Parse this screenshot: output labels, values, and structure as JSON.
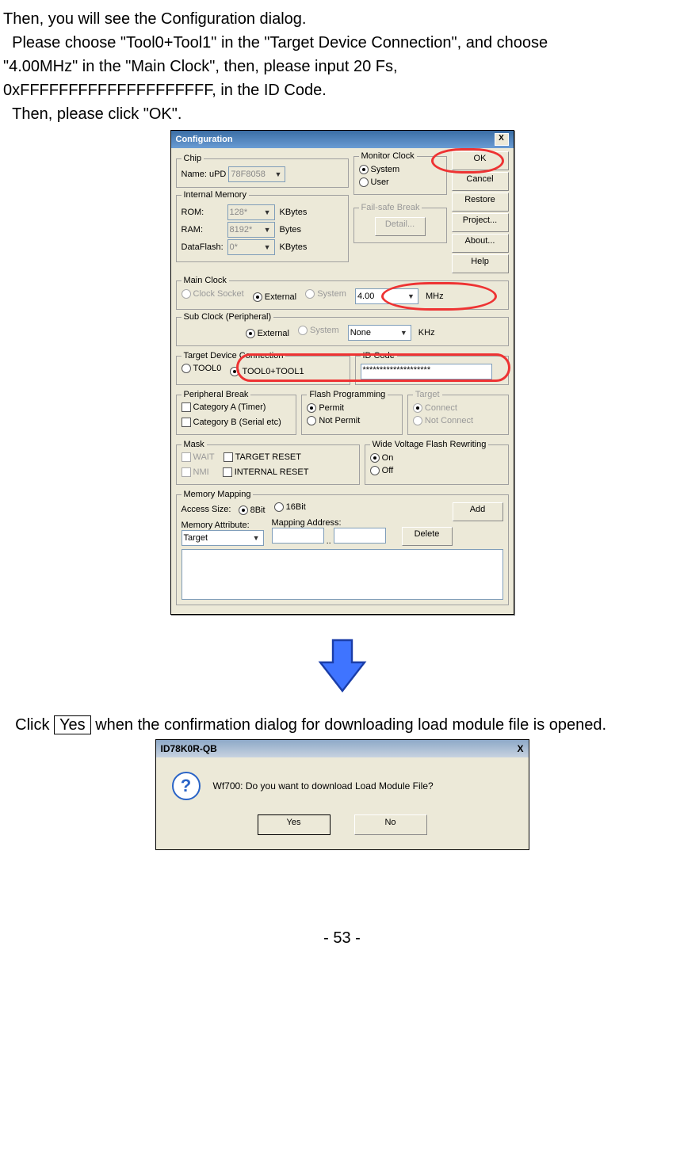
{
  "intro": {
    "l1": "Then, you will see the Configuration dialog.",
    "l2": "Please choose \"Tool0+Tool1\" in the \"Target Device Connection\", and choose",
    "l3": "\"4.00MHz\" in the \"Main Clock\", then, please input 20 Fs,",
    "l4": "0xFFFFFFFFFFFFFFFFFFFF, in the ID Code.",
    "l5": "Then, please click \"OK\"."
  },
  "config": {
    "title": "Configuration",
    "x": "X",
    "chip": {
      "legend": "Chip",
      "name_label": "Name:   uPD",
      "name_value": "78F8058"
    },
    "internal_mem": {
      "legend": "Internal Memory",
      "rom_label": "ROM:",
      "rom_value": "128*",
      "rom_unit": "KBytes",
      "ram_label": "RAM:",
      "ram_value": "8192*",
      "ram_unit": "Bytes",
      "df_label": "DataFlash:",
      "df_value": "0*",
      "df_unit": "KBytes"
    },
    "monitor_clock": {
      "legend": "Monitor Clock",
      "system": "System",
      "user": "User"
    },
    "failsafe": {
      "legend": "Fail-safe Break",
      "btn": "Detail..."
    },
    "buttons": {
      "ok": "OK",
      "cancel": "Cancel",
      "restore": "Restore",
      "project": "Project...",
      "about": "About...",
      "help": "Help"
    },
    "main_clock": {
      "legend": "Main Clock",
      "clock_socket": "Clock Socket",
      "external": "External",
      "system": "System",
      "value": "4.00",
      "unit": "MHz"
    },
    "sub_clock": {
      "legend": "Sub Clock (Peripheral)",
      "external": "External",
      "system": "System",
      "value": "None",
      "unit": "KHz"
    },
    "tdc": {
      "legend": "Target Device Connection",
      "tool0": "TOOL0",
      "tool01": "TOOL0+TOOL1"
    },
    "idcode": {
      "legend": "ID Code",
      "value": "********************"
    },
    "pbreak": {
      "legend": "Peripheral Break",
      "a": "Category A (Timer)",
      "b": "Category B (Serial etc)"
    },
    "fprog": {
      "legend": "Flash Programming",
      "permit": "Permit",
      "notpermit": "Not Permit"
    },
    "target": {
      "legend": "Target",
      "connect": "Connect",
      "notconnect": "Not Connect"
    },
    "mask": {
      "legend": "Mask",
      "wait": "WAIT",
      "treset": "TARGET RESET",
      "nmi": "NMI",
      "ireset": "INTERNAL RESET"
    },
    "wvfr": {
      "legend": "Wide Voltage Flash Rewriting",
      "on": "On",
      "off": "Off"
    },
    "memmap": {
      "legend": "Memory Mapping",
      "access_size": "Access Size:",
      "b8": "8Bit",
      "b16": "16Bit",
      "attr_label": "Memory Attribute:",
      "map_label": "Mapping Address:",
      "attr_value": "Target",
      "sep": "..",
      "add": "Add",
      "delete": "Delete"
    }
  },
  "confirm_line": {
    "pre": "Click ",
    "yes": "Yes",
    "post": " when the confirmation dialog for downloading load module file is opened."
  },
  "msgbox": {
    "title": "ID78K0R-QB",
    "x": "X",
    "qmark": "?",
    "text": "Wf700: Do you want to download Load Module File?",
    "yes": "Yes",
    "no": "No"
  },
  "footer": "- 53 -"
}
